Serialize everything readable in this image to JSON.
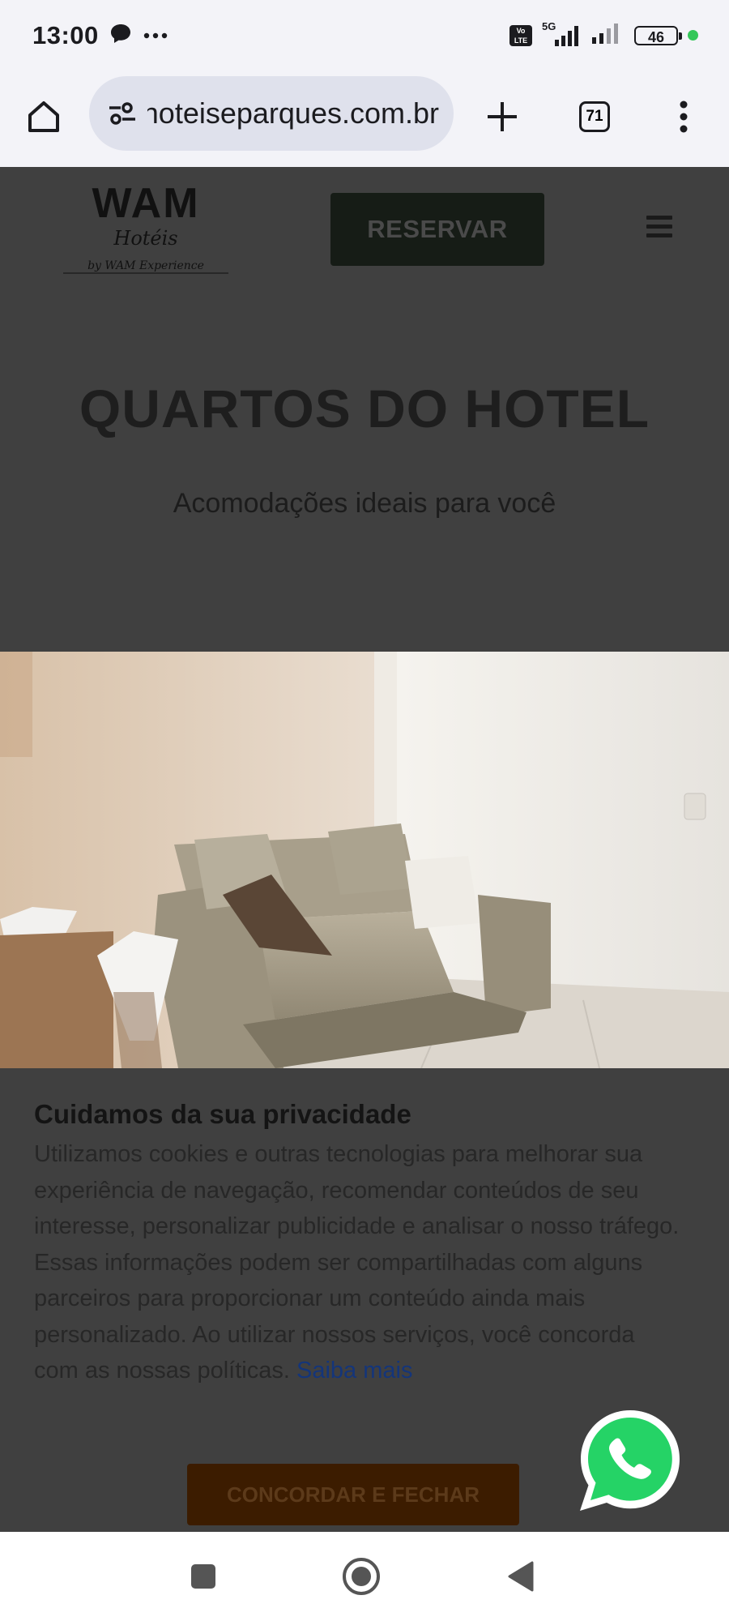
{
  "status_bar": {
    "time": "13:00",
    "icons": [
      "chat-bubble-icon",
      "more-dots-icon",
      "volte-icon",
      "5g-signal-icon",
      "signal-icon",
      "battery-icon"
    ],
    "network": "5G",
    "volte": "Vo LTE",
    "battery_level": "46"
  },
  "browser": {
    "url": "hoteiseparques.com.br",
    "tab_count": "71",
    "icons": [
      "home-icon",
      "site-settings-icon",
      "new-tab-icon",
      "tab-switcher-icon",
      "menu-dots-icon"
    ]
  },
  "site": {
    "logo": {
      "brand": "WAM",
      "sub": "Hotéis",
      "byline": "by WAM Experience"
    },
    "reserve_label": "RESERVAR",
    "title": "QUARTOS DO HOTEL",
    "subtitle": "Acomodações ideais para você"
  },
  "cookie_banner": {
    "title": "Cuidamos da sua privacidade",
    "body": "Utilizamos cookies e outras tecnologias para melhorar sua experiência de navegação, recomendar conteúdos de seu interesse, personalizar publicidade e analisar o nosso tráfego. Essas informações podem ser compartilhadas com alguns parceiros para proporcionar um conteúdo ainda mais personalizado. Ao utilizar nossos serviços, você concorda com as nossas políticas.",
    "link_label": "Saiba mais",
    "accept_label": "CONCORDAR E FECHAR"
  },
  "colors": {
    "overlay_bg": "#404040",
    "reserve_button": "#161c16",
    "accept_button": "#3c1c00",
    "whatsapp": "#25d366",
    "link": "#14357a"
  },
  "nav_bar": {
    "icons": [
      "recents-square-icon",
      "home-circle-icon",
      "back-triangle-icon"
    ]
  }
}
